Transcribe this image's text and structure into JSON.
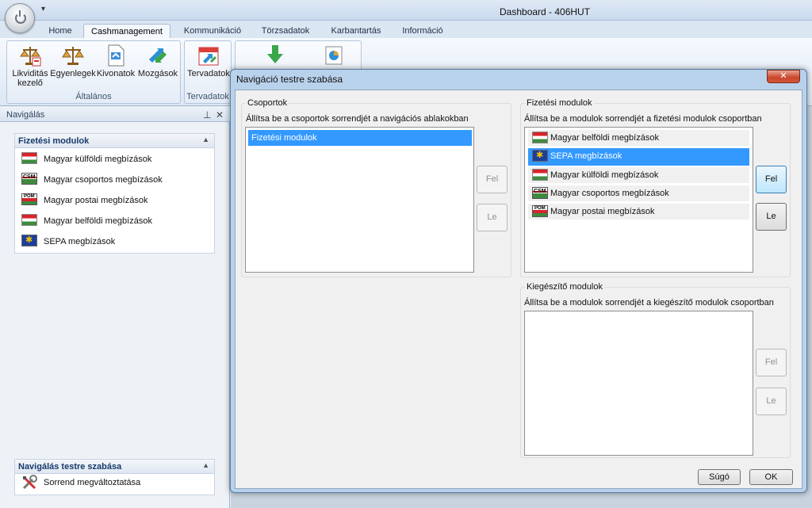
{
  "window": {
    "title": "Dashboard - 406HUT",
    "qat_glyph": "▾"
  },
  "ribbon": {
    "tabs": [
      "Home",
      "Cashmanagement",
      "Kommunikáció",
      "Törzsadatok",
      "Karbantartás",
      "Információ"
    ],
    "active_tab": "Cashmanagement",
    "groups": [
      {
        "label": "Általános",
        "buttons": [
          "Likviditás kezelő",
          "Egyenlegek",
          "Kivonatok",
          "Mozgások"
        ]
      },
      {
        "label": "Tervadatok",
        "buttons": [
          "Tervadatok"
        ]
      }
    ]
  },
  "nav": {
    "header": "Navigálás",
    "pin_glyph": "⊥",
    "close_glyph": "✕",
    "section1": {
      "title": "Fizetési modulok",
      "items": [
        {
          "label": "Magyar külföldi megbízások",
          "icon": "flag-hu-icon"
        },
        {
          "label": "Magyar csoportos megbízások",
          "icon": "csm-icon"
        },
        {
          "label": "Magyar postai megbízások",
          "icon": "pom-icon"
        },
        {
          "label": "Magyar belföldi megbízások",
          "icon": "flag-hu-icon"
        },
        {
          "label": "SEPA megbízások",
          "icon": "eu-flag-icon"
        }
      ]
    },
    "section2": {
      "title": "Navigálás testre szabása",
      "items": [
        {
          "label": "Sorrend megváltoztatása",
          "icon": "tools-icon"
        }
      ]
    }
  },
  "dialog": {
    "title": "Navigáció testre szabása",
    "close_glyph": "✕",
    "groups": {
      "title": "Csoportok",
      "desc": "Állítsa be a csoportok sorrendjét a navigációs ablakokban",
      "items": [
        "Fizetési modulok"
      ],
      "selected": "Fizetési modulok",
      "up_label": "Fel",
      "down_label": "Le"
    },
    "payment": {
      "title": "Fizetési modulok",
      "desc": "Állítsa be a modulok sorrendjét a fizetési modulok csoportban",
      "items": [
        "Magyar belföldi megbízások",
        "SEPA megbízások",
        "Magyar külföldi megbízások",
        "Magyar csoportos megbízások",
        "Magyar postai megbízások"
      ],
      "selected": "SEPA megbízások",
      "up_label": "Fel",
      "down_label": "Le"
    },
    "extra": {
      "title": "Kiegészítő modulok",
      "desc": "Állítsa be a modulok sorrendjét a kiegészítő modulok csoportban",
      "items": [],
      "up_label": "Fel",
      "down_label": "Le"
    },
    "help_label": "Súgó",
    "ok_label": "OK"
  }
}
